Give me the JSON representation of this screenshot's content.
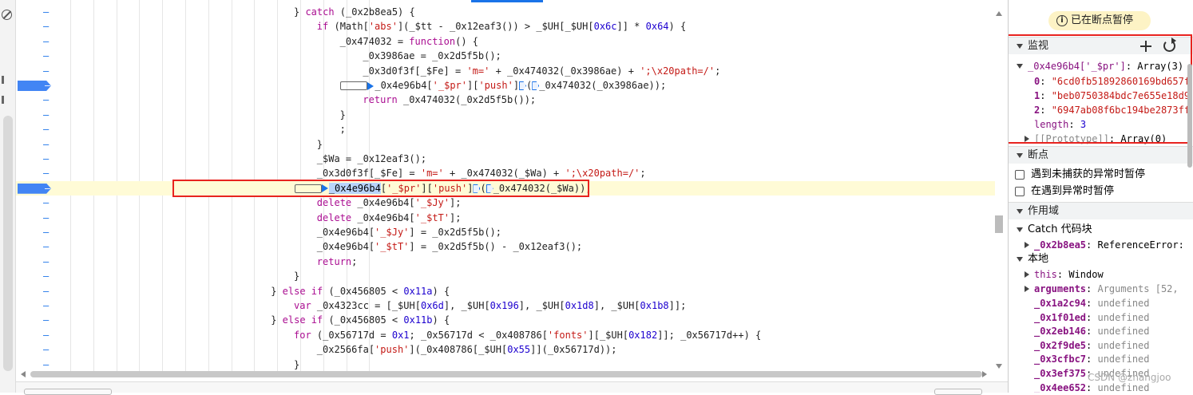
{
  "editor": {
    "lines": [
      {
        "marker": "dash",
        "indent": 10,
        "tokens": [
          [
            "pl",
            "} "
          ],
          [
            "kw",
            "catch"
          ],
          [
            "pl",
            " (_0x2b8ea5) {"
          ]
        ]
      },
      {
        "marker": "dash",
        "indent": 11,
        "tokens": [
          [
            "kw",
            "if"
          ],
          [
            "pl",
            " (Math["
          ],
          [
            "str",
            "'abs'"
          ],
          [
            "pl",
            "](_$tt - _0x12eaf3()) > _$UH[_$UH["
          ],
          [
            "num",
            "0x6c"
          ],
          [
            "pl",
            "]] * "
          ],
          [
            "num",
            "0x64"
          ],
          [
            "pl",
            ") {"
          ]
        ]
      },
      {
        "marker": "dash",
        "indent": 12,
        "tokens": [
          [
            "pl",
            "_0x474032 = "
          ],
          [
            "kw",
            "function"
          ],
          [
            "pl",
            "() {"
          ]
        ]
      },
      {
        "marker": "dash",
        "indent": 13,
        "tokens": [
          [
            "pl",
            "_0x3986ae = _0x2d5f5b();"
          ]
        ]
      },
      {
        "marker": "dash",
        "indent": 13,
        "tokens": [
          [
            "pl",
            "_0x3d0f3f[_$Fe] = "
          ],
          [
            "str",
            "'m='"
          ],
          [
            "pl",
            " + _0x474032(_0x3986ae) + "
          ],
          [
            "str",
            "';\\x20path=/'"
          ],
          [
            "pl",
            ";"
          ]
        ]
      },
      {
        "marker": "bp",
        "indent": 13,
        "pre": "box",
        "tokens": [
          [
            "pl",
            "_0x4e96b4["
          ],
          [
            "str",
            "'_$pr'"
          ],
          [
            "pl",
            "]["
          ],
          [
            "str",
            "'push'"
          ],
          [
            "pl",
            "]"
          ],
          [
            "tri2",
            ""
          ],
          [
            "pl",
            "("
          ],
          [
            "tri2",
            ""
          ],
          [
            "pl",
            "_0x474032(_0x3986ae));"
          ]
        ]
      },
      {
        "marker": "dash",
        "indent": 13,
        "tokens": [
          [
            "kw",
            "return"
          ],
          [
            "pl",
            " _0x474032(_0x2d5f5b());"
          ]
        ]
      },
      {
        "marker": "dash",
        "indent": 12,
        "tokens": [
          [
            "pl",
            "}"
          ]
        ]
      },
      {
        "marker": "dash",
        "indent": 12,
        "tokens": [
          [
            "pl",
            ";"
          ]
        ]
      },
      {
        "marker": "dash",
        "indent": 11,
        "tokens": [
          [
            "pl",
            "}"
          ]
        ]
      },
      {
        "marker": "dash",
        "indent": 11,
        "tokens": [
          [
            "pl",
            "_$Wa = _0x12eaf3();"
          ]
        ]
      },
      {
        "marker": "dash",
        "indent": 11,
        "tokens": [
          [
            "pl",
            "_0x3d0f3f[_$Fe] = "
          ],
          [
            "str",
            "'m='"
          ],
          [
            "pl",
            " + _0x474032(_$Wa) + "
          ],
          [
            "str",
            "';\\x20path=/'"
          ],
          [
            "pl",
            ";"
          ]
        ]
      },
      {
        "marker": "bp",
        "indent": 11,
        "paused": true,
        "pre": "box-tri",
        "tokens": [
          [
            "hl",
            "_0x4e96b4"
          ],
          [
            "pl",
            "["
          ],
          [
            "str",
            "'_$pr'"
          ],
          [
            "pl",
            "]["
          ],
          [
            "str",
            "'push'"
          ],
          [
            "pl",
            "]"
          ],
          [
            "tri2",
            ""
          ],
          [
            "pl",
            "("
          ],
          [
            "tri2",
            ""
          ],
          [
            "pl",
            "_0x474032(_$Wa));"
          ]
        ]
      },
      {
        "marker": "dash",
        "indent": 11,
        "tokens": [
          [
            "kw",
            "delete"
          ],
          [
            "pl",
            " _0x4e96b4["
          ],
          [
            "str",
            "'_$Jy'"
          ],
          [
            "pl",
            "];"
          ]
        ]
      },
      {
        "marker": "dash",
        "indent": 11,
        "tokens": [
          [
            "kw",
            "delete"
          ],
          [
            "pl",
            " _0x4e96b4["
          ],
          [
            "str",
            "'_$tT'"
          ],
          [
            "pl",
            "];"
          ]
        ]
      },
      {
        "marker": "dash",
        "indent": 11,
        "tokens": [
          [
            "pl",
            "_0x4e96b4["
          ],
          [
            "str",
            "'_$Jy'"
          ],
          [
            "pl",
            "] = _0x2d5f5b();"
          ]
        ]
      },
      {
        "marker": "dash",
        "indent": 11,
        "tokens": [
          [
            "pl",
            "_0x4e96b4["
          ],
          [
            "str",
            "'_$tT'"
          ],
          [
            "pl",
            "] = _0x2d5f5b() - _0x12eaf3();"
          ]
        ]
      },
      {
        "marker": "dash",
        "indent": 11,
        "tokens": [
          [
            "kw",
            "return"
          ],
          [
            "pl",
            ";"
          ]
        ]
      },
      {
        "marker": "dash",
        "indent": 10,
        "tokens": [
          [
            "pl",
            "}"
          ]
        ]
      },
      {
        "marker": "dash",
        "indent": 9,
        "tokens": [
          [
            "pl",
            "} "
          ],
          [
            "kw",
            "else if"
          ],
          [
            "pl",
            " (_0x456805 < "
          ],
          [
            "num",
            "0x11a"
          ],
          [
            "pl",
            ") {"
          ]
        ]
      },
      {
        "marker": "dash",
        "indent": 10,
        "tokens": [
          [
            "kw",
            "var"
          ],
          [
            "pl",
            " _0x4323cc = [_$UH["
          ],
          [
            "num",
            "0x6d"
          ],
          [
            "pl",
            "], _$UH["
          ],
          [
            "num",
            "0x196"
          ],
          [
            "pl",
            "], _$UH["
          ],
          [
            "num",
            "0x1d8"
          ],
          [
            "pl",
            "], _$UH["
          ],
          [
            "num",
            "0x1b8"
          ],
          [
            "pl",
            "]];"
          ]
        ]
      },
      {
        "marker": "dash",
        "indent": 9,
        "tokens": [
          [
            "pl",
            "} "
          ],
          [
            "kw",
            "else if"
          ],
          [
            "pl",
            " (_0x456805 < "
          ],
          [
            "num",
            "0x11b"
          ],
          [
            "pl",
            ") {"
          ]
        ]
      },
      {
        "marker": "dash",
        "indent": 10,
        "tokens": [
          [
            "kw",
            "for"
          ],
          [
            "pl",
            " (_0x56717d = "
          ],
          [
            "num",
            "0x1"
          ],
          [
            "pl",
            "; _0x56717d < _0x408786["
          ],
          [
            "str",
            "'fonts'"
          ],
          [
            "pl",
            "][_$UH["
          ],
          [
            "num",
            "0x182"
          ],
          [
            "pl",
            "]]; _0x56717d++) {"
          ]
        ]
      },
      {
        "marker": "dash",
        "indent": 11,
        "tokens": [
          [
            "pl",
            "_0x2566fa["
          ],
          [
            "str",
            "'push'"
          ],
          [
            "pl",
            "](_0x408786[_$UH["
          ],
          [
            "num",
            "0x55"
          ],
          [
            "pl",
            "]](_0x56717d));"
          ]
        ]
      },
      {
        "marker": "dash",
        "indent": 10,
        "tokens": [
          [
            "pl",
            "}"
          ]
        ]
      }
    ]
  },
  "sidebar": {
    "paused_label": "已在断点暂停",
    "watch": {
      "title": "监视",
      "expr_name": "_0x4e96b4['_$pr']",
      "expr_type": "Array(3)",
      "items": [
        {
          "key": "0",
          "value": "\"6cd0fb51892860169bd657f"
        },
        {
          "key": "1",
          "value": "\"beb0750384bdc7e655e18d9"
        },
        {
          "key": "2",
          "value": "\"6947ab08f6bc194be2873ff"
        }
      ],
      "length_key": "length",
      "length_value": "3",
      "proto_key": "[[Prototype]]",
      "proto_value": "Array(0)"
    },
    "breakpoints": {
      "title": "断点",
      "opt1": "遇到未捕获的异常时暂停",
      "opt2": "在遇到异常时暂停"
    },
    "scope": {
      "title": "作用域",
      "catch_block": "Catch 代码块",
      "catch_var": "_0x2b8ea5",
      "catch_val": "ReferenceError: ",
      "local": "本地",
      "this_key": "this",
      "this_val": "Window",
      "args_key": "arguments",
      "args_val": "Arguments  [52,",
      "vars": [
        {
          "key": "_0x1a2c94",
          "value": "undefined"
        },
        {
          "key": "_0x1f01ed",
          "value": "undefined"
        },
        {
          "key": "_0x2eb146",
          "value": "undefined"
        },
        {
          "key": "_0x2f9de5",
          "value": "undefined"
        },
        {
          "key": "_0x3cfbc7",
          "value": "undefined"
        },
        {
          "key": "_0x3ef375",
          "value": "undefined"
        },
        {
          "key": "_0x4ee652",
          "value": "undefined"
        }
      ]
    }
  },
  "watermark": "CSDN @zhangjoo"
}
